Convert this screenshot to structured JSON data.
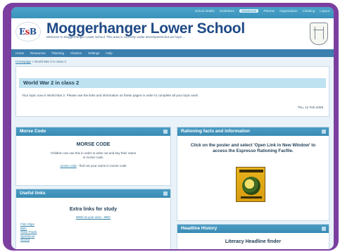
{
  "topnav": {
    "items": [
      "School details",
      "Guidelines",
      "Classroom",
      "Parents",
      "Organisation",
      "Clubbing",
      "Logout"
    ],
    "active_index": 2
  },
  "header": {
    "logo_text_a": "E",
    "logo_text_b": "s",
    "logo_text_c": "B",
    "title": "Moggerhanger Lower School",
    "subtitle": "Welcome to Moggerhanger Lower School. This area is currently under development but we hope ..."
  },
  "menu": {
    "items": [
      "Home",
      "Resources",
      "Planning",
      "Classes",
      "Settings",
      "Help"
    ]
  },
  "breadcrumb": {
    "link": "Homepage",
    "sep": " > ",
    "current": "World War 2 in class 2"
  },
  "page": {
    "title": "World War 2 in class 2",
    "intro": "Your topic now is World War 2. Please use the links and information on these pages in order to complete all your topic work.",
    "date": "Thu, 12 Feb 2009"
  },
  "blocks": {
    "morse": {
      "title": "Morse Code",
      "heading": "MORSE CODE",
      "text": "Children can use this in order to write out and key their name in morse code.",
      "link": "morse code",
      "link_suffix": " - find out your name in morse code"
    },
    "useful": {
      "title": "Useful links",
      "heading": "Extra links for study",
      "sub": "WW2 at your door - BBC",
      "items": [
        "Film Clips",
        "BBC",
        "Anne Frank",
        "Spartacus",
        "Sound"
      ]
    },
    "rationing": {
      "title": "Rationing facts and information",
      "text": "Click on the poster and select 'Open Link in New Window' to access the Espresso Rationing Facfile."
    },
    "headline": {
      "title": "Headline History",
      "heading": "Literacy Headline finder"
    }
  },
  "colors": {
    "frame": "#7b3fa0",
    "accent": "#3a8bb4",
    "title": "#1e4a86"
  }
}
